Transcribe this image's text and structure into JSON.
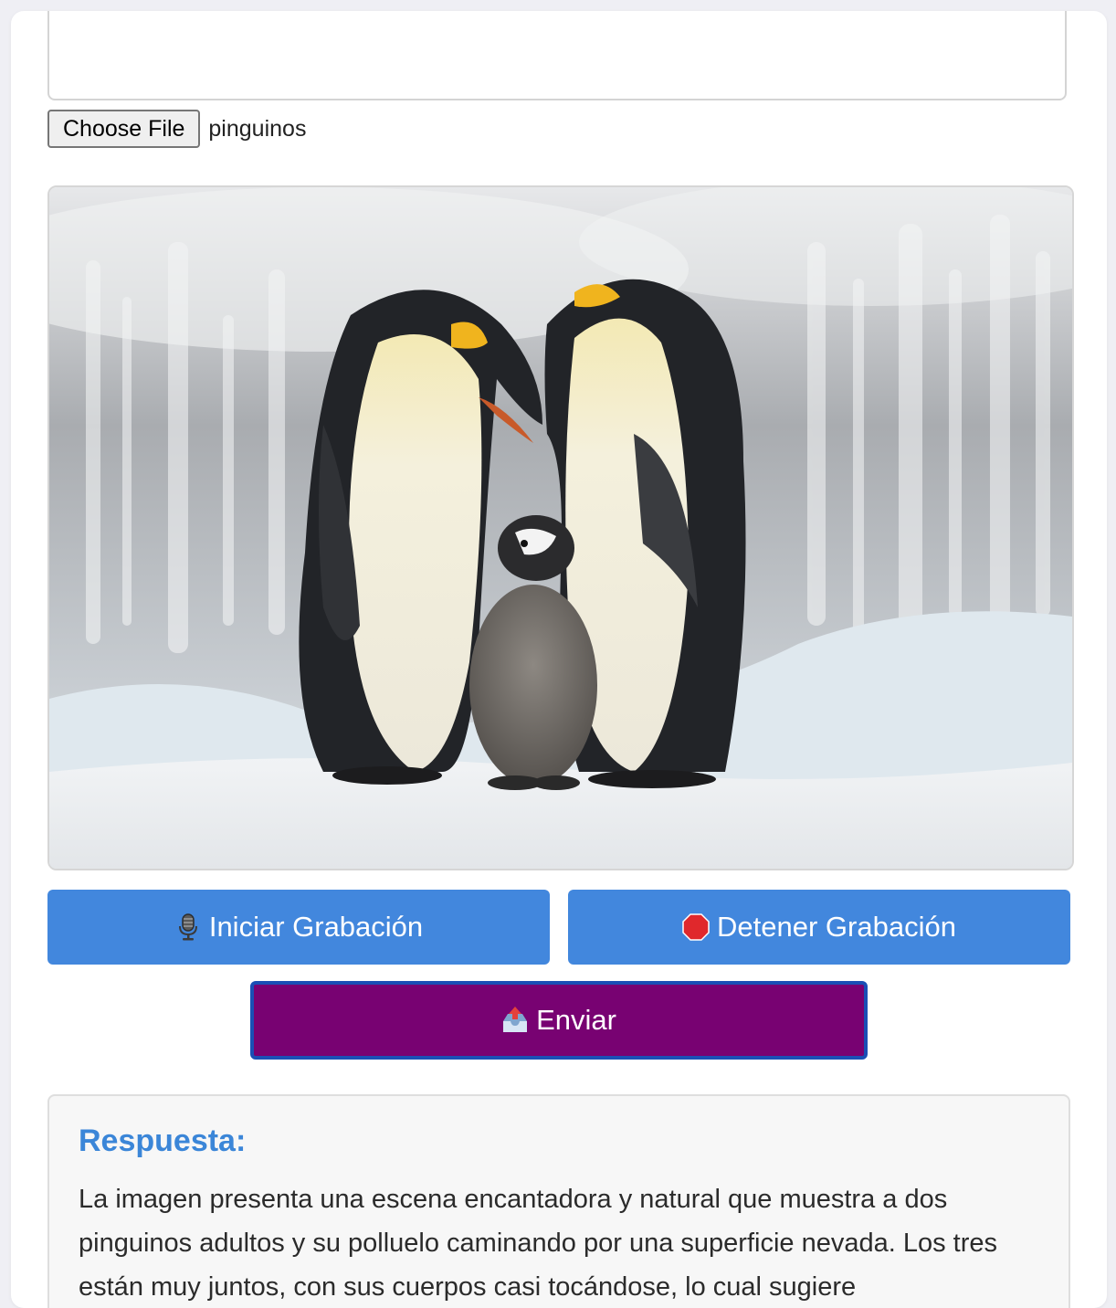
{
  "form": {
    "prompt_value": "",
    "file_button_label": "Choose File",
    "file_name": "pinguinos"
  },
  "preview": {
    "icon": "photo-emperor-penguins"
  },
  "controls": {
    "start_icon": "microphone-icon",
    "start_label": "Iniciar Grabación",
    "stop_icon": "stop-sign-icon",
    "stop_label": "Detener Grabación",
    "send_icon": "outbox-tray-icon",
    "send_label": "Enviar"
  },
  "response": {
    "title": "Respuesta:",
    "text": "La imagen presenta una escena encantadora y natural que muestra a dos pinguinos adultos y su polluelo caminando por una superficie nevada. Los tres están muy juntos, con sus cuerpos casi tocándose, lo cual sugiere"
  },
  "colors": {
    "record_button": "#4287dd",
    "send_button": "#780272",
    "send_border": "#1a4fb5",
    "response_title": "#3b86d8"
  }
}
